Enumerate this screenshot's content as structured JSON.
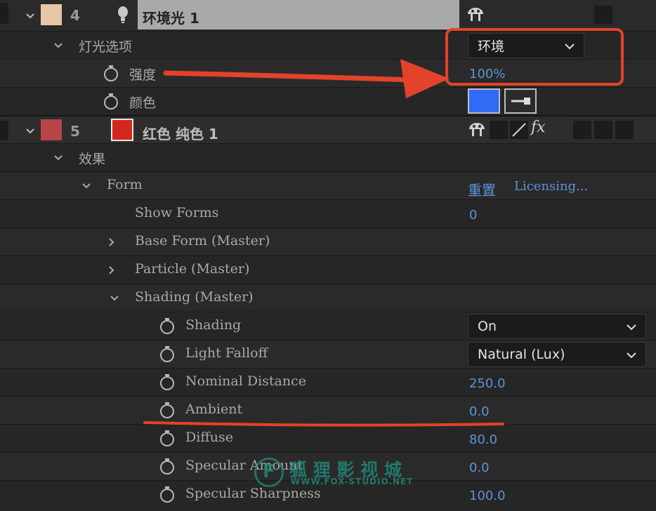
{
  "layer4": {
    "number": "4",
    "name": "环境光 1",
    "sub_group": "灯光选项",
    "props": [
      {
        "label": "强度",
        "value": "100%"
      },
      {
        "label": "颜色"
      }
    ],
    "light_type": "环境",
    "color_swatch": "#2f6bf5",
    "label_color": "#e8c7a6"
  },
  "layer5": {
    "number": "5",
    "name": "红色 纯色 1",
    "label_color": "#b8444a",
    "solid_color": "#d4261f",
    "effects_group": "效果",
    "effect": {
      "name": "Form",
      "reset_label": "重置",
      "licensing_label": "Licensing...",
      "show_forms": {
        "label": "Show Forms",
        "value": "0"
      },
      "base_form": "Base Form (Master)",
      "particle": "Particle (Master)",
      "shading_group": "Shading (Master)",
      "shading": {
        "label": "Shading",
        "value": "On"
      },
      "light_falloff": {
        "label": "Light Falloff",
        "value": "Natural (Lux)"
      },
      "nominal_distance": {
        "label": "Nominal Distance",
        "value": "250.0"
      },
      "ambient": {
        "label": "Ambient",
        "value": "0.0"
      },
      "diffuse": {
        "label": "Diffuse",
        "value": "80.0"
      },
      "specular_amount": {
        "label": "Specular Amount",
        "value": "0.0"
      },
      "specular_sharpness": {
        "label": "Specular Sharpness",
        "value": "100.0"
      }
    }
  },
  "watermark": {
    "text": "狐 狸 影 视 城",
    "url": "WWW.FOX-STUDIO.NET"
  },
  "annotation_color": "#e2432a"
}
